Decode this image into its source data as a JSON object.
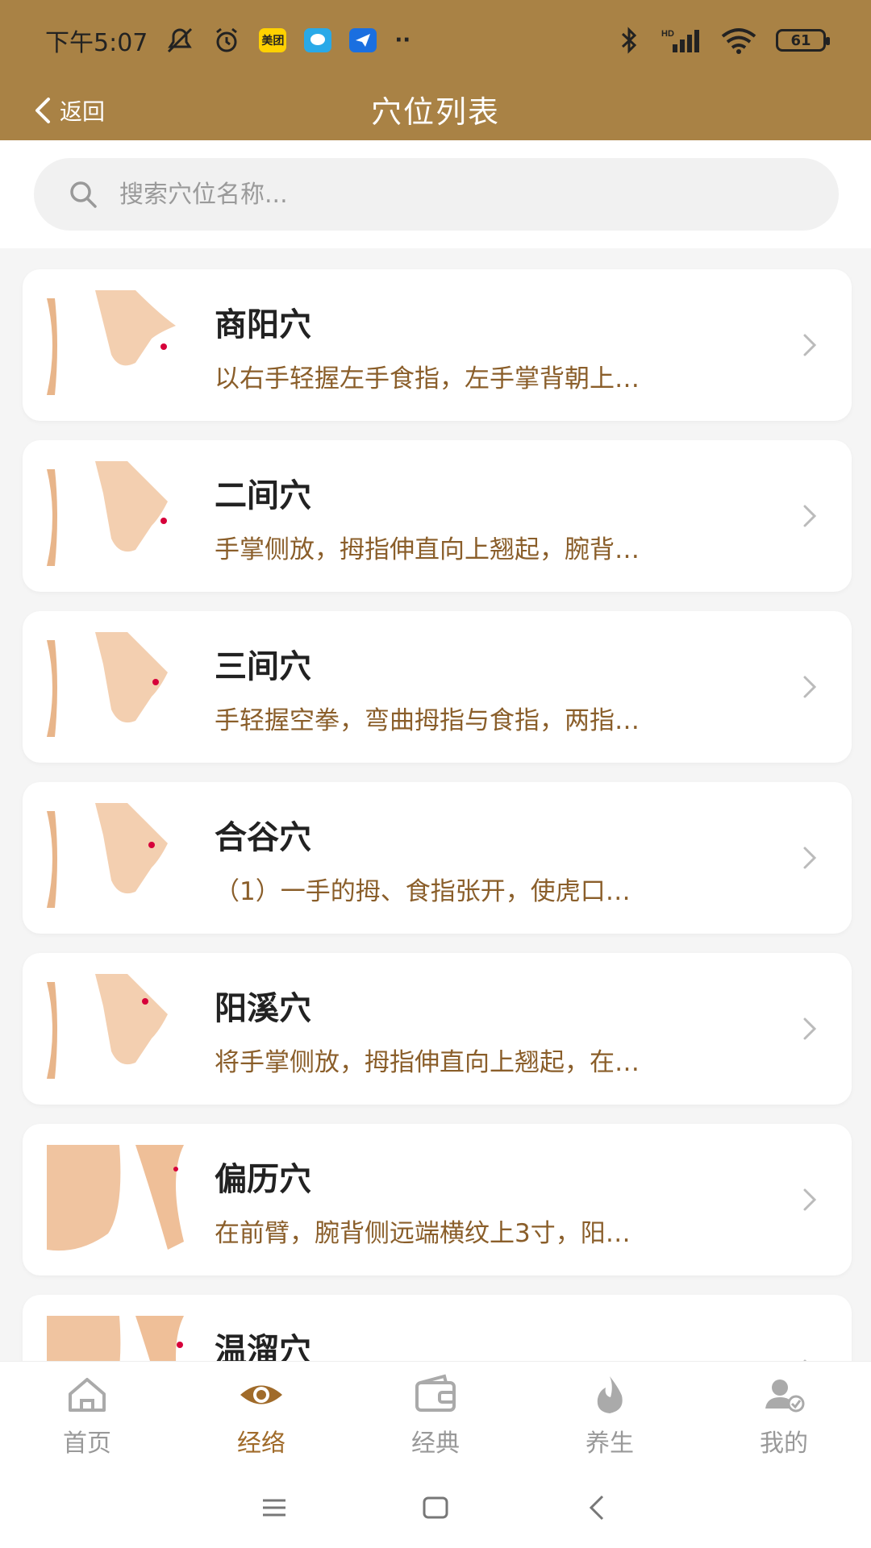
{
  "status_bar": {
    "time": "下午5:07",
    "app_badges": [
      "美团"
    ],
    "more": "··",
    "battery": "61"
  },
  "nav": {
    "back_label": "返回",
    "title": "穴位列表"
  },
  "search": {
    "placeholder": "搜索穴位名称..."
  },
  "acupoints": [
    {
      "name": "商阳穴",
      "desc": "以右手轻握左手食指，左手掌背朝上…"
    },
    {
      "name": "二间穴",
      "desc": "手掌侧放，拇指伸直向上翘起，腕背…"
    },
    {
      "name": "三间穴",
      "desc": "手轻握空拳，弯曲拇指与食指，两指…"
    },
    {
      "name": "合谷穴",
      "desc": "（1）一手的拇、食指张开，使虎口…"
    },
    {
      "name": "阳溪穴",
      "desc": "将手掌侧放，拇指伸直向上翘起，在…"
    },
    {
      "name": "偏历穴",
      "desc": "在前臂，腕背侧远端横纹上3寸，阳…"
    },
    {
      "name": "温溜穴",
      "desc": ""
    }
  ],
  "tabs": [
    {
      "label": "首页",
      "icon": "home-icon"
    },
    {
      "label": "经络",
      "icon": "eye-icon"
    },
    {
      "label": "经典",
      "icon": "wallet-icon"
    },
    {
      "label": "养生",
      "icon": "flame-icon"
    },
    {
      "label": "我的",
      "icon": "user-check-icon"
    }
  ],
  "colors": {
    "header": "#a98245",
    "active_tab": "#a06b2a",
    "desc_text": "#8a5e2a"
  }
}
